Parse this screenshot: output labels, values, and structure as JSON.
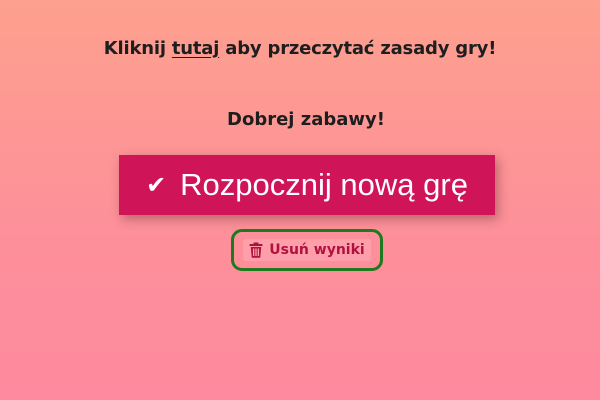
{
  "intro": {
    "before": "Kliknij ",
    "link": "tutaj",
    "after": " aby przeczytać zasady gry!"
  },
  "greeting": "Dobrej zabawy!",
  "start_button": {
    "icon": "check-icon",
    "label": "Rozpocznij nową grę"
  },
  "reset_button": {
    "icon": "trash-icon",
    "label": "Usuń wyniki"
  },
  "colors": {
    "background_top": "#fda08e",
    "background_bottom": "#fd8a9e",
    "primary_button": "#cf1558",
    "reset_text": "#b0123f",
    "highlight_border": "#1f7a1f"
  }
}
